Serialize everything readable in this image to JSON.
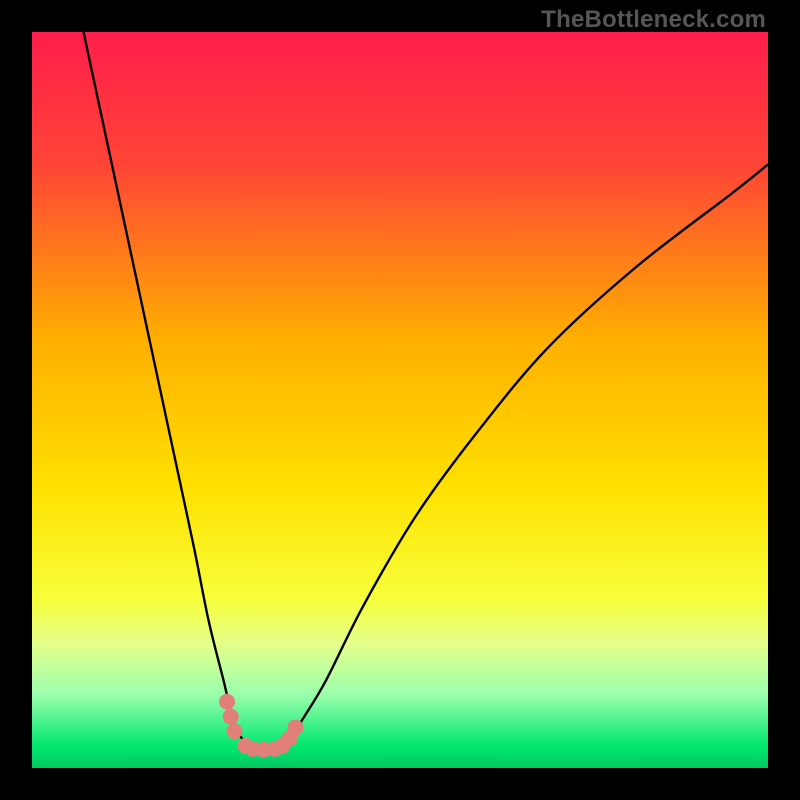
{
  "watermark": {
    "text": "TheBottleneck.com"
  },
  "chart_data": {
    "type": "line",
    "title": "",
    "xlabel": "",
    "ylabel": "",
    "xlim": [
      0,
      100
    ],
    "ylim": [
      0,
      100
    ],
    "grid": false,
    "gradient_stops": [
      {
        "pct": 0,
        "color": "#ff1e4b"
      },
      {
        "pct": 18,
        "color": "#ff4436"
      },
      {
        "pct": 42,
        "color": "#ffb000"
      },
      {
        "pct": 62,
        "color": "#ffe100"
      },
      {
        "pct": 77,
        "color": "#f7ff3a"
      },
      {
        "pct": 83,
        "color": "#e5ff8a"
      },
      {
        "pct": 90,
        "color": "#9bffad"
      },
      {
        "pct": 97,
        "color": "#00e86e"
      },
      {
        "pct": 100,
        "color": "#00c95f"
      }
    ],
    "series": [
      {
        "name": "bottleneck-curve",
        "color": "#000000",
        "x": [
          7,
          10,
          13,
          16,
          19,
          22,
          24,
          26,
          27.5,
          29,
          31,
          33,
          35,
          37,
          40,
          45,
          52,
          60,
          70,
          82,
          95,
          100
        ],
        "y": [
          100,
          86,
          72,
          58,
          44,
          30,
          20,
          12,
          6,
          3.5,
          2.5,
          2.5,
          4,
          7,
          12,
          22,
          34,
          45,
          57,
          68,
          78,
          82
        ]
      }
    ],
    "markers": {
      "name": "highlight-points",
      "color": "#e08079",
      "x": [
        26.5,
        27,
        27.5,
        29,
        30,
        31.5,
        33,
        34,
        35,
        35.8
      ],
      "y": [
        9,
        7,
        5,
        3,
        2.6,
        2.5,
        2.6,
        3,
        4,
        5.5
      ]
    }
  }
}
